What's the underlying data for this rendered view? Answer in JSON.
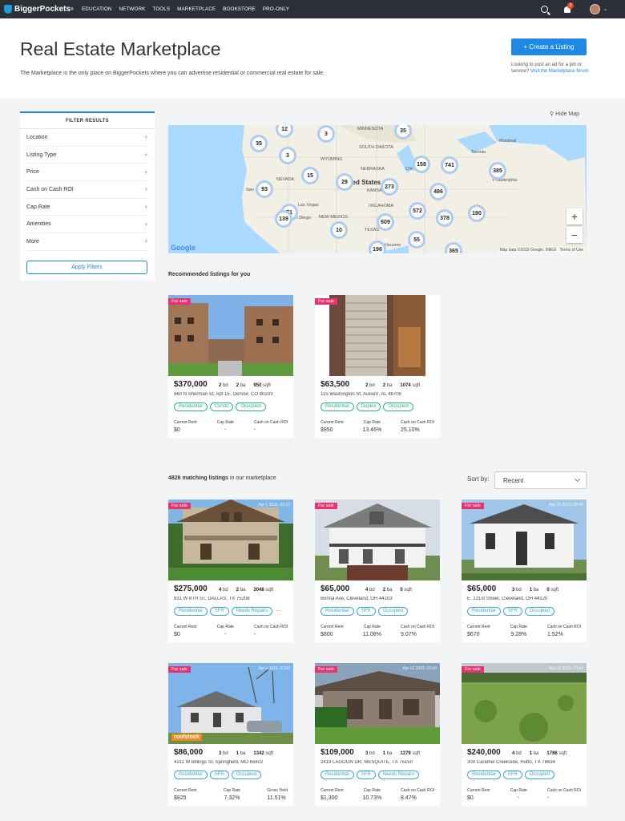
{
  "nav": {
    "brand": "BiggerPockets",
    "items": [
      "EDUCATION",
      "NETWORK",
      "TOOLS",
      "MARKETPLACE",
      "BOOKSTORE",
      "PRO-ONLY"
    ],
    "notif_count": "2"
  },
  "header": {
    "title": "Real Estate Marketplace",
    "subtitle": "The Marketplace is the only place on BiggerPockets where you can advertise residential or commercial real estate for sale.",
    "create_label": "+ Create a Listing",
    "post_note": "Looking to post an ad for a job or service?",
    "post_link": "Visit the Marketplace forum"
  },
  "filter": {
    "title": "FILTER RESULTS",
    "rows": [
      "Location",
      "Listing Type",
      "Price",
      "Cash on Cash ROI",
      "Cap Rate",
      "Amenities",
      "More"
    ],
    "apply": "Apply Filters"
  },
  "map": {
    "hide_label": "Hide Map",
    "pins": [
      "12",
      "3",
      "35",
      "35",
      "3",
      "158",
      "741",
      "385",
      "15",
      "29",
      "273",
      "486",
      "93",
      "190",
      "71",
      "572",
      "378",
      "139",
      "609",
      "10",
      "55",
      "196",
      "365"
    ],
    "labels": [
      "MINNESOTA",
      "SOUTH DAKOTA",
      "WYOMING",
      "NEBRASKA",
      "NEVADA",
      "United States",
      "KANSAS",
      "OKLAHOMA",
      "NEW MEXICO",
      "TEXAS",
      "Toronto",
      "Montreal",
      "Chicago",
      "Philadelphia",
      "Las Vegas",
      "San Diego",
      "Houston",
      "San"
    ],
    "data_note": "Map data ©2019 Google, INEGI",
    "terms": "Terms of Use",
    "google": "Google"
  },
  "recommended_label": "Recommended listings for you",
  "matching": {
    "count": "4826 matching listings",
    "suffix": " in our marketplace"
  },
  "sort": {
    "label": "Sort by:",
    "value": "Recent"
  },
  "recommended": [
    {
      "badge": "For sale",
      "date": "",
      "price": "$370,000",
      "bd": "2",
      "ba": "2",
      "sqft": "950",
      "address": "960 N Sherman St, Apt 1E, Denver, CO 80203",
      "tags": [
        "Residential",
        "Condo",
        "Occupied"
      ],
      "more": "",
      "labels": [
        "Current Rent",
        "Cap Rate",
        "Cash on Cash ROI"
      ],
      "values": [
        "$0",
        "-",
        "-"
      ]
    },
    {
      "badge": "For sale",
      "date": "",
      "price": "$63,500",
      "bd": "2",
      "ba": "2",
      "sqft": "1074",
      "address": "115 Washington St, Auburn, AL 46706",
      "tags": [
        "Residential",
        "Duplex",
        "Occupied"
      ],
      "more": "",
      "labels": [
        "Current Rent",
        "Cap Rate",
        "Cash on Cash ROI"
      ],
      "values": [
        "$950",
        "13.46%",
        "25.10%"
      ]
    }
  ],
  "listings": [
    {
      "badge": "For sale",
      "date": "Apr 1 2019, 02:10",
      "price": "$275,000",
      "bd": "4",
      "ba": "2",
      "sqft": "2048",
      "address": "931 W 8TH ST, DALLAS, TX 75208",
      "tags": [
        "Residential",
        "SFR",
        "Needs Repairs"
      ],
      "more": "...",
      "labels": [
        "Current Rent",
        "Cap Rate",
        "Cash on Cash ROI"
      ],
      "values": [
        "$0",
        "-",
        "-"
      ]
    },
    {
      "badge": "For sale",
      "date": "",
      "price": "$65,000",
      "bd": "4",
      "ba": "2",
      "sqft": "0",
      "address": "Bonna Ave, Cleveland, OH 44103",
      "tags": [
        "Residential",
        "SFR",
        "Occupied"
      ],
      "more": "",
      "labels": [
        "Current Rent",
        "Cap Rate",
        "Cash on Cash ROI"
      ],
      "values": [
        "$800",
        "11.08%",
        "9.07%"
      ]
    },
    {
      "badge": "For sale",
      "date": "Apr 15 2019, 03:49",
      "price": "$65,000",
      "bd": "3",
      "ba": "1",
      "sqft": "0",
      "address": "E. 131st Street, Cleveland, OH 44120",
      "tags": [
        "Residential",
        "SFR",
        "Occupied"
      ],
      "more": "",
      "labels": [
        "Current Rent",
        "Cap Rate",
        "Cash on Cash ROI"
      ],
      "values": [
        "$670",
        "9.28%",
        "1.52%"
      ]
    },
    {
      "badge": "For sale",
      "date": "Apr 4 2019, 02:00",
      "price": "$86,000",
      "bd": "3",
      "ba": "1",
      "sqft": "1342",
      "address": "4311 W Billings St, Springfield, MO 65802",
      "tags": [
        "Residential",
        "SFR",
        "Occupied"
      ],
      "more": "",
      "labels": [
        "Current Rent",
        "Cap Rate",
        "Gross Yield"
      ],
      "values": [
        "$825",
        "7.32%",
        "11.51%"
      ],
      "brand": "roofstock"
    },
    {
      "badge": "For sale",
      "date": "Apr 15 2019, 03:49",
      "price": "$109,000",
      "bd": "3",
      "ba": "1",
      "sqft": "1279",
      "address": "2419 LAGOON DR, MESQUITE, TX 75150",
      "tags": [
        "Residential",
        "SFR",
        "Needs Repairs"
      ],
      "more": "",
      "labels": [
        "Current Rent",
        "Cap Rate",
        "Cash on Cash ROI"
      ],
      "values": [
        "$1,300",
        "10.73%",
        "8.47%"
      ]
    },
    {
      "badge": "For sale",
      "date": "Apr 15 2019, 03:49",
      "price": "$240,000",
      "bd": "4",
      "ba": "1",
      "sqft": "1786",
      "address": "300 Caramel Creekside, Hutto, TX 78634",
      "tags": [
        "Residential",
        "SFR",
        "Occupied"
      ],
      "more": "",
      "labels": [
        "Current Rent",
        "Cap Rate",
        "Cash on Cash ROI"
      ],
      "values": [
        "$0",
        "-",
        "-"
      ]
    }
  ],
  "units": {
    "bd": "bd",
    "ba": "ba",
    "sqft": "sqft"
  },
  "colors": {
    "brand_blue": "#1e88e5",
    "sale_badge": "#e8336e",
    "tag_green": "#2eb872",
    "tag_blue": "#3ba5d8",
    "nav_bg": "#2c3036"
  }
}
